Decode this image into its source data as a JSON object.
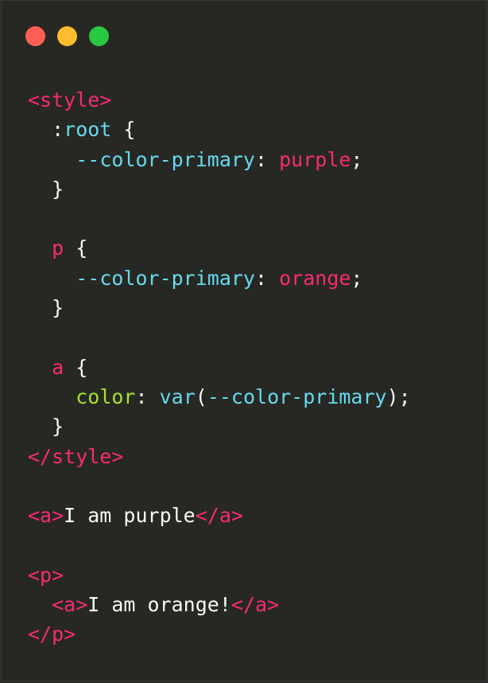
{
  "window": {
    "controls": [
      {
        "name": "close",
        "color": "#ff5f57"
      },
      {
        "name": "minimize",
        "color": "#febc2e"
      },
      {
        "name": "zoom",
        "color": "#28c840"
      }
    ]
  },
  "colors": {
    "background": "#272823",
    "tag": "#f92a72",
    "property": "#66d9ef",
    "keyword": "#a6e22e",
    "text": "#f8f8f2"
  },
  "code": {
    "lines": [
      [
        {
          "t": "<style>",
          "c": "t-pink"
        }
      ],
      [
        {
          "t": "  :",
          "c": "t-white"
        },
        {
          "t": "root",
          "c": "t-cyan"
        },
        {
          "t": " {",
          "c": "t-white"
        }
      ],
      [
        {
          "t": "    ",
          "c": "t-white"
        },
        {
          "t": "--color-primary",
          "c": "t-cyan"
        },
        {
          "t": ": ",
          "c": "t-white"
        },
        {
          "t": "purple",
          "c": "t-pink"
        },
        {
          "t": ";",
          "c": "t-white"
        }
      ],
      [
        {
          "t": "  }",
          "c": "t-white"
        }
      ],
      [
        {
          "t": "",
          "c": "t-white"
        }
      ],
      [
        {
          "t": "  ",
          "c": "t-white"
        },
        {
          "t": "p",
          "c": "t-pink"
        },
        {
          "t": " {",
          "c": "t-white"
        }
      ],
      [
        {
          "t": "    ",
          "c": "t-white"
        },
        {
          "t": "--color-primary",
          "c": "t-cyan"
        },
        {
          "t": ": ",
          "c": "t-white"
        },
        {
          "t": "orange",
          "c": "t-pink"
        },
        {
          "t": ";",
          "c": "t-white"
        }
      ],
      [
        {
          "t": "  }",
          "c": "t-white"
        }
      ],
      [
        {
          "t": "",
          "c": "t-white"
        }
      ],
      [
        {
          "t": "  ",
          "c": "t-white"
        },
        {
          "t": "a",
          "c": "t-pink"
        },
        {
          "t": " {",
          "c": "t-white"
        }
      ],
      [
        {
          "t": "    ",
          "c": "t-white"
        },
        {
          "t": "color",
          "c": "t-green"
        },
        {
          "t": ": ",
          "c": "t-white"
        },
        {
          "t": "var",
          "c": "t-cyan"
        },
        {
          "t": "(",
          "c": "t-white"
        },
        {
          "t": "--color-primary",
          "c": "t-cyan"
        },
        {
          "t": ");",
          "c": "t-white"
        }
      ],
      [
        {
          "t": "  }",
          "c": "t-white"
        }
      ],
      [
        {
          "t": "</style>",
          "c": "t-pink"
        }
      ],
      [
        {
          "t": "",
          "c": "t-white"
        }
      ],
      [
        {
          "t": "<a>",
          "c": "t-pink"
        },
        {
          "t": "I am purple",
          "c": "t-white"
        },
        {
          "t": "</a>",
          "c": "t-pink"
        }
      ],
      [
        {
          "t": "",
          "c": "t-white"
        }
      ],
      [
        {
          "t": "<p>",
          "c": "t-pink"
        }
      ],
      [
        {
          "t": "  ",
          "c": "t-white"
        },
        {
          "t": "<a>",
          "c": "t-pink"
        },
        {
          "t": "I am orange!",
          "c": "t-white"
        },
        {
          "t": "</a>",
          "c": "t-pink"
        }
      ],
      [
        {
          "t": "</p>",
          "c": "t-pink"
        }
      ]
    ]
  }
}
